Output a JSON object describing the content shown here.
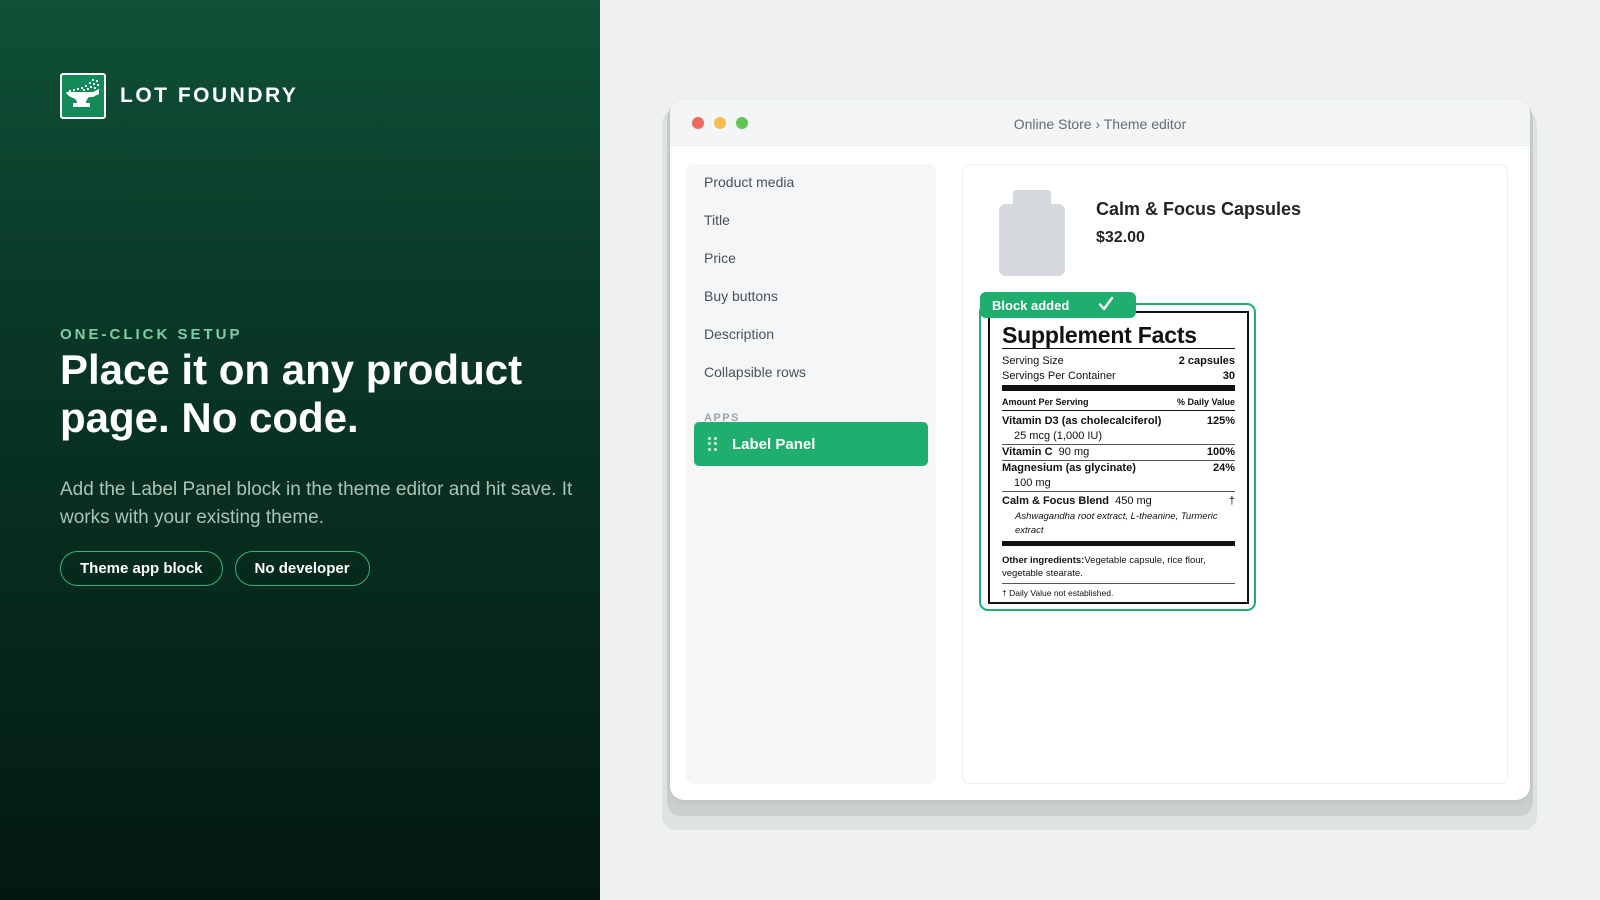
{
  "brand": {
    "name": "LOT FOUNDRY"
  },
  "hero": {
    "eyebrow": "ONE-CLICK SETUP",
    "headline": "Place it on any product page. No code.",
    "subtitle": "Add the Label Panel block in the theme editor and hit save. It works with your existing theme.",
    "pills": [
      "Theme app block",
      "No developer"
    ]
  },
  "window": {
    "breadcrumb": "Online Store › Theme editor"
  },
  "sidebar": {
    "items": [
      "Product media",
      "Title",
      "Price",
      "Buy buttons",
      "Description",
      "Collapsible rows"
    ],
    "section_heading": "APPS",
    "active_item": "Label Panel"
  },
  "product": {
    "title": "Calm & Focus Capsules",
    "price": "$32.00"
  },
  "block_tag": "Block added",
  "label": {
    "title": "Supplement Facts",
    "serving_size_label": "Serving Size",
    "serving_size_value": "2 capsules",
    "servings_label": "Servings Per Container",
    "servings_value": "30",
    "amount_header": "Amount Per Serving",
    "dv_header": "% Daily Value",
    "n1_name": "Vitamin D3 (as cholecalciferol)",
    "n1_dv": "125%",
    "n1_amount": "25 mcg (1,000 IU)",
    "n2_name": "Vitamin C",
    "n2_amount": "90 mg",
    "n2_dv": "100%",
    "n3_name": "Magnesium (as glycinate)",
    "n3_dv": "24%",
    "n3_amount": "100 mg",
    "n4_name": "Calm & Focus Blend",
    "n4_amount": "450 mg",
    "n4_dv": "†",
    "n4_ingredients": "Ashwagandha root extract, L-theanine, Turmeric extract",
    "other_label": "Other ingredients:",
    "other_value": "Vegetable capsule, rice flour, vegetable stearate.",
    "footnote": "† Daily Value not established."
  },
  "colors": {
    "accent": "#1eae6e",
    "left_panel_top": "#0f5238",
    "left_panel_bottom": "#04180f",
    "eyebrow": "#7fcfa6"
  }
}
